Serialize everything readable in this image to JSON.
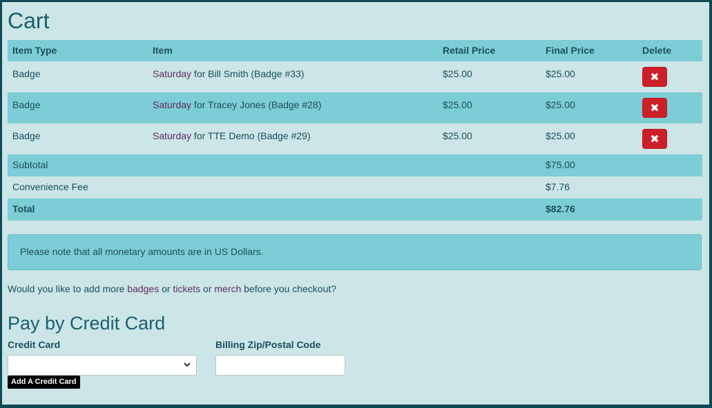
{
  "page": {
    "title": "Cart"
  },
  "table": {
    "headers": [
      "Item Type",
      "Item",
      "Retail Price",
      "Final Price",
      "Delete"
    ],
    "rows": [
      {
        "type": "Badge",
        "item_link": "Saturday",
        "item_rest": " for Bill Smith (Badge #33)",
        "retail": "$25.00",
        "final": "$25.00"
      },
      {
        "type": "Badge",
        "item_link": "Saturday",
        "item_rest": " for Tracey Jones (Badge #28)",
        "retail": "$25.00",
        "final": "$25.00"
      },
      {
        "type": "Badge",
        "item_link": "Saturday",
        "item_rest": " for TTE Demo (Badge #29)",
        "retail": "$25.00",
        "final": "$25.00"
      }
    ],
    "delete_icon": "✖",
    "subtotal": {
      "label": "Subtotal",
      "value": "$75.00"
    },
    "fee": {
      "label": "Convenience Fee",
      "value": "$7.76"
    },
    "total": {
      "label": "Total",
      "value": "$82.76"
    }
  },
  "note": "Please note that all monetary amounts are in US Dollars.",
  "more": {
    "prefix": "Would you like to add more ",
    "badges": "badges",
    "or1": " or ",
    "tickets": "tickets",
    "or2": " or ",
    "merch": "merch",
    "suffix": " before you checkout?"
  },
  "payment": {
    "title": "Pay by Credit Card",
    "card_label": "Credit Card",
    "card_value": "",
    "zip_label": "Billing Zip/Postal Code",
    "zip_value": "",
    "add_card": "Add A Credit Card"
  },
  "colors": {
    "accent": "#7ccdd5",
    "panel": "#cce5e6",
    "delete": "#cc1f2a",
    "link": "#5b2d5e"
  }
}
